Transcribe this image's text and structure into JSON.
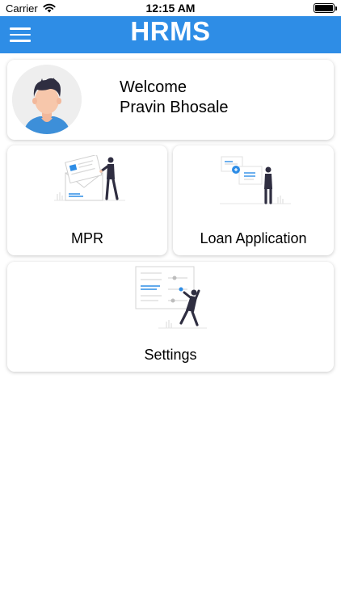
{
  "status_bar": {
    "carrier": "Carrier",
    "time": "12:15 AM",
    "wifi_icon": "wifi-icon",
    "battery_icon": "battery-icon"
  },
  "app_bar": {
    "title": "HRMS",
    "menu_icon": "hamburger-menu-icon",
    "color": "#2e8de6"
  },
  "welcome": {
    "greeting": "Welcome",
    "name": "Pravin Bhosale",
    "avatar_icon": "user-avatar-icon"
  },
  "menu_cards": [
    {
      "label": "MPR",
      "illustration": "mpr-illustration-icon"
    },
    {
      "label": "Loan Application",
      "illustration": "loan-application-illustration-icon"
    },
    {
      "label": "Settings",
      "illustration": "settings-illustration-icon"
    }
  ],
  "colors": {
    "accent": "#2e8de6",
    "illustration_blue": "#2e8de6",
    "figure_dark": "#2f2e41"
  }
}
